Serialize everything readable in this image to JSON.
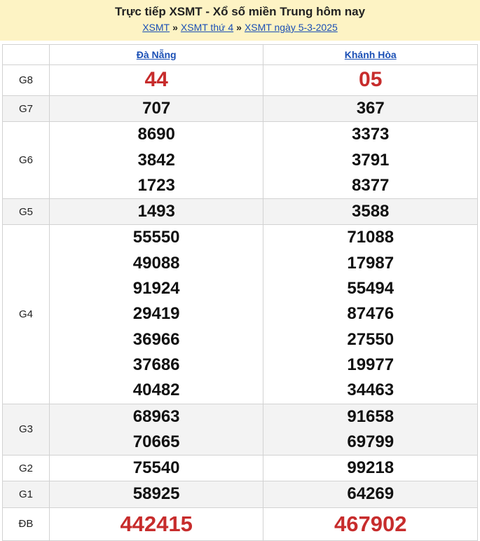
{
  "header": {
    "title": "Trực tiếp XSMT - Xổ số miền Trung hôm nay",
    "breadcrumbs": [
      "XSMT",
      "XSMT thứ 4",
      "XSMT ngày 5-3-2025"
    ],
    "separator": "»"
  },
  "table": {
    "provinces": [
      "Đà Nẵng",
      "Khánh Hòa"
    ],
    "rows": [
      {
        "label": "G8",
        "values": [
          [
            "44"
          ],
          [
            "05"
          ]
        ]
      },
      {
        "label": "G7",
        "values": [
          [
            "707"
          ],
          [
            "367"
          ]
        ]
      },
      {
        "label": "G6",
        "values": [
          [
            "8690",
            "3842",
            "1723"
          ],
          [
            "3373",
            "3791",
            "8377"
          ]
        ]
      },
      {
        "label": "G5",
        "values": [
          [
            "1493"
          ],
          [
            "3588"
          ]
        ]
      },
      {
        "label": "G4",
        "values": [
          [
            "55550",
            "49088",
            "91924",
            "29419",
            "36966",
            "37686",
            "40482"
          ],
          [
            "71088",
            "17987",
            "55494",
            "87476",
            "27550",
            "19977",
            "34463"
          ]
        ]
      },
      {
        "label": "G3",
        "values": [
          [
            "68963",
            "70665"
          ],
          [
            "91658",
            "69799"
          ]
        ]
      },
      {
        "label": "G2",
        "values": [
          [
            "75540"
          ],
          [
            "99218"
          ]
        ]
      },
      {
        "label": "G1",
        "values": [
          [
            "58925"
          ],
          [
            "64269"
          ]
        ]
      },
      {
        "label": "ĐB",
        "values": [
          [
            "442415"
          ],
          [
            "467902"
          ]
        ]
      }
    ]
  },
  "colors": {
    "header_bg": "#fdf3c4",
    "link": "#1a4fb5",
    "highlight": "#c72c2c",
    "alt_row_bg": "#f3f3f3"
  }
}
